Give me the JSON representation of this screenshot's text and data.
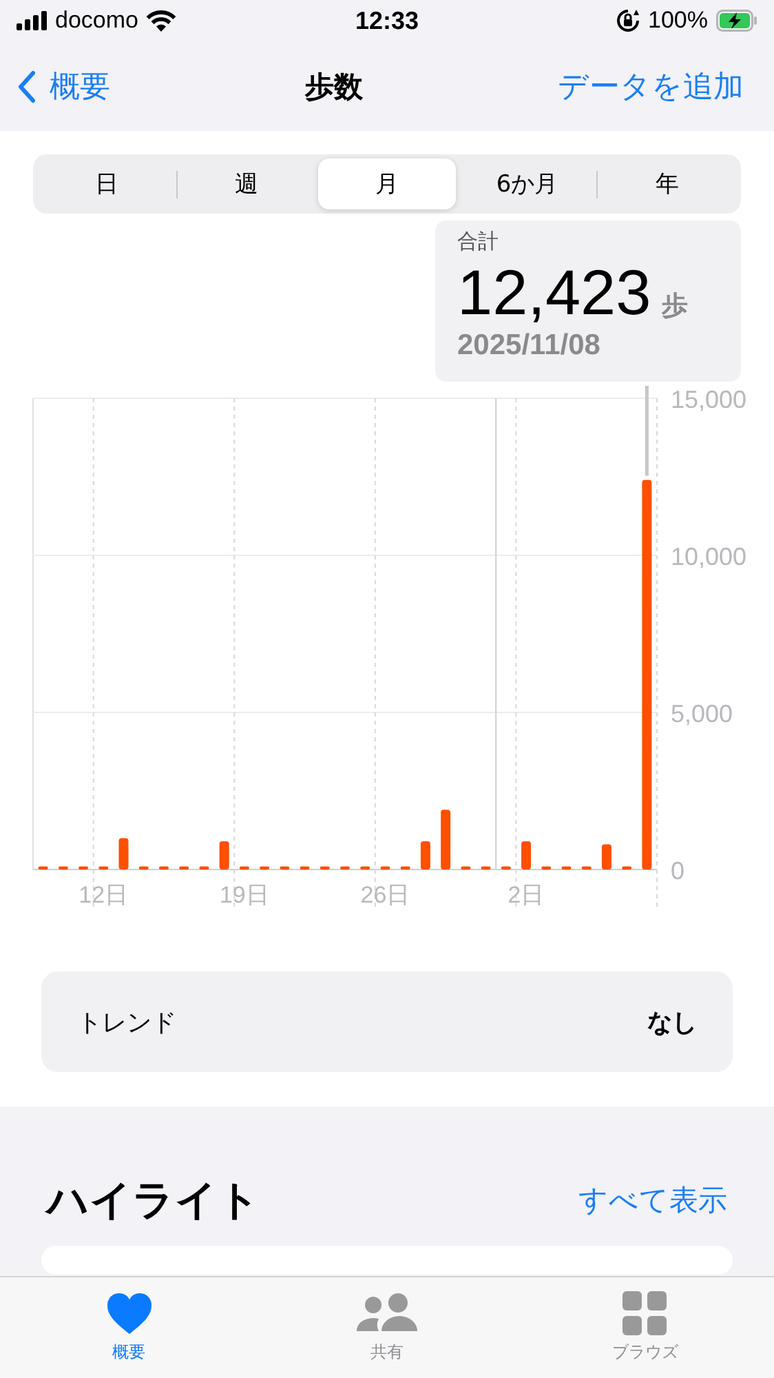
{
  "status_bar": {
    "carrier": "docomo",
    "time": "12:33",
    "battery": "100%"
  },
  "nav": {
    "back": "概要",
    "title": "歩数",
    "action": "データを追加"
  },
  "segments": [
    {
      "label": "日",
      "selected": false
    },
    {
      "label": "週",
      "selected": false
    },
    {
      "label": "月",
      "selected": true
    },
    {
      "label": "6か月",
      "selected": false
    },
    {
      "label": "年",
      "selected": false
    }
  ],
  "callout": {
    "label": "合計",
    "value": "12,423",
    "unit": "歩",
    "date": "2025/11/08"
  },
  "chart": {
    "chart_data": {
      "type": "bar",
      "categories": [
        null,
        null,
        null,
        "12日",
        null,
        null,
        null,
        null,
        null,
        null,
        "19日",
        null,
        null,
        null,
        null,
        null,
        null,
        "26日",
        null,
        null,
        null,
        null,
        null,
        null,
        "2日",
        null,
        null,
        null,
        null,
        null,
        null
      ],
      "series": [
        {
          "color": "#ff4f00",
          "values": [
            100,
            100,
            100,
            100,
            1000,
            100,
            100,
            100,
            100,
            900,
            100,
            100,
            100,
            100,
            100,
            100,
            100,
            100,
            100,
            900,
            1900,
            100,
            100,
            100,
            900,
            100,
            100,
            100,
            800,
            100,
            12400
          ]
        }
      ],
      "ylim": [
        0,
        15000
      ],
      "yticks": [
        {
          "value": 0,
          "label": "0"
        },
        {
          "value": 5000,
          "label": "5,000"
        },
        {
          "value": 10000,
          "label": "10,000"
        },
        {
          "value": 15000,
          "label": "15,000"
        }
      ]
    }
  },
  "trend": {
    "label": "トレンド",
    "value": "なし"
  },
  "highlights": {
    "title": "ハイライト",
    "link": "すべて表示"
  },
  "tab_bar": [
    {
      "label": "概要",
      "kind": "heart",
      "selected": true
    },
    {
      "label": "共有",
      "kind": "people",
      "selected": false
    },
    {
      "label": "ブラウズ",
      "kind": "grid",
      "selected": false
    }
  ]
}
